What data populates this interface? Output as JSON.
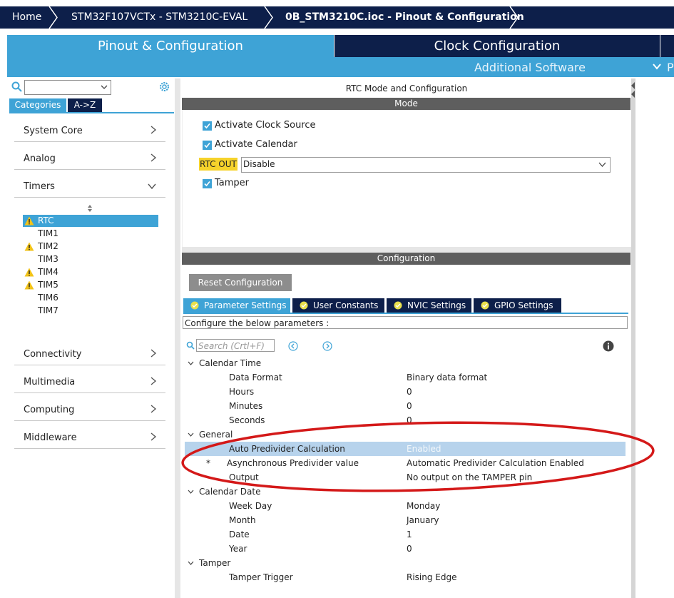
{
  "breadcrumb": {
    "items": [
      "Home",
      "STM32F107VCTx  -  STM3210C-EVAL",
      "0B_STM3210C.ioc - Pinout & Configuration"
    ]
  },
  "tabs": {
    "pinout": "Pinout & Configuration",
    "clock": "Clock Configuration",
    "additional": "Additional Software",
    "edge": "P"
  },
  "left_panel": {
    "categories_tab": "Categories",
    "az_tab": "A->Z",
    "categories": [
      "System Core",
      "Analog",
      "Timers",
      "Connectivity",
      "Multimedia",
      "Computing",
      "Middleware"
    ],
    "timers": [
      {
        "name": "RTC",
        "warning": true,
        "selected": true
      },
      {
        "name": "TIM1",
        "warning": false,
        "selected": false
      },
      {
        "name": "TIM2",
        "warning": true,
        "selected": false
      },
      {
        "name": "TIM3",
        "warning": false,
        "selected": false
      },
      {
        "name": "TIM4",
        "warning": true,
        "selected": false
      },
      {
        "name": "TIM5",
        "warning": true,
        "selected": false
      },
      {
        "name": "TIM6",
        "warning": false,
        "selected": false
      },
      {
        "name": "TIM7",
        "warning": false,
        "selected": false
      }
    ]
  },
  "mode": {
    "title": "RTC Mode and Configuration",
    "header": "Mode",
    "activate_clock_source": "Activate Clock Source",
    "activate_calendar": "Activate Calendar",
    "rtc_out_label": "RTC OUT",
    "rtc_out_value": "Disable",
    "tamper": "Tamper"
  },
  "config": {
    "header": "Configuration",
    "reset_button": "Reset Configuration",
    "param_tabs": [
      "Parameter Settings",
      "User Constants",
      "NVIC Settings",
      "GPIO Settings"
    ],
    "configure_text": "Configure the below parameters :",
    "search_placeholder": "Search (Crtl+F)",
    "groups": [
      {
        "name": "Calendar Time",
        "params": [
          {
            "name": "Data Format",
            "value": "Binary data format"
          },
          {
            "name": "Hours",
            "value": "0"
          },
          {
            "name": "Minutes",
            "value": "0"
          },
          {
            "name": "Seconds",
            "value": "0"
          }
        ]
      },
      {
        "name": "General",
        "params": [
          {
            "name": "Auto Predivider Calculation",
            "value": "Enabled"
          },
          {
            "name": "Asynchronous Predivider value",
            "value": "Automatic Predivider Calculation Enabled",
            "star": "*"
          },
          {
            "name": "Output",
            "value": "No output on the TAMPER pin"
          }
        ]
      },
      {
        "name": "Calendar Date",
        "params": [
          {
            "name": "Week Day",
            "value": "Monday"
          },
          {
            "name": "Month",
            "value": "January"
          },
          {
            "name": "Date",
            "value": "1"
          },
          {
            "name": "Year",
            "value": "0"
          }
        ]
      },
      {
        "name": "Tamper",
        "params": [
          {
            "name": "Tamper Trigger",
            "value": "Rising Edge"
          }
        ]
      }
    ]
  },
  "colors": {
    "navy": "#0d1f4a",
    "accent": "#3ea3d6",
    "highlight": "#f6d32b",
    "annotation": "#d41919"
  }
}
